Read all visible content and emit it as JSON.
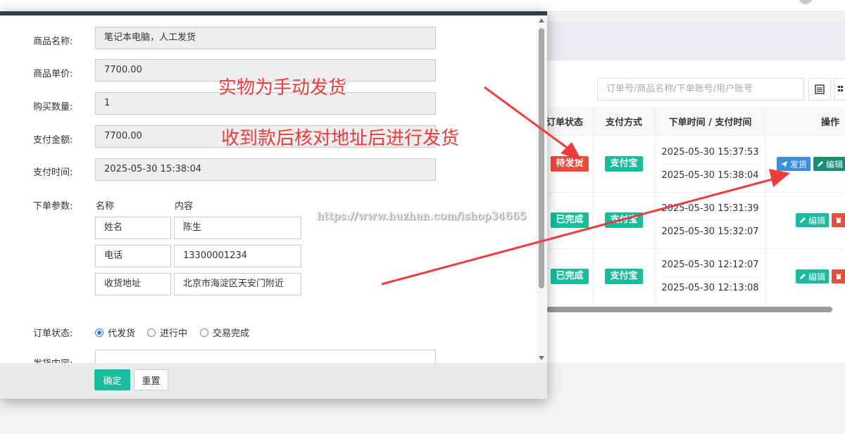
{
  "table": {
    "search_placeholder": "订单号/商品名称/下单账号/用户账号",
    "headers": [
      "订单状态",
      "支付方式",
      "下单时间 / 支付时间",
      "操作"
    ],
    "rows": [
      {
        "status": "待发货",
        "status_color": "#e74c3c",
        "pay": "支付宝",
        "order_time": "2025-05-30 15:37:53",
        "pay_time": "2025-05-30 15:38:04"
      },
      {
        "status": "已完成",
        "status_color": "#1abc9c",
        "pay": "支付宝",
        "order_time": "2025-05-30 15:31:39",
        "pay_time": "2025-05-30 15:32:07"
      },
      {
        "status": "已完成",
        "status_color": "#1abc9c",
        "pay": "支付宝",
        "order_time": "2025-05-30 12:12:07",
        "pay_time": "2025-05-30 12:13:08"
      }
    ],
    "actions": {
      "ship": "发货",
      "edit": "编辑"
    }
  },
  "modal": {
    "fields": [
      {
        "label": "商品名称:",
        "value": "笔记本电脑，人工发货"
      },
      {
        "label": "商品单价:",
        "value": "7700.00"
      },
      {
        "label": "购买数量:",
        "value": "1"
      },
      {
        "label": "支付金额:",
        "value": "7700.00"
      },
      {
        "label": "支付时间:",
        "value": "2025-05-30 15:38:04"
      }
    ],
    "params": {
      "label": "下单参数:",
      "col_name": "名称",
      "col_content": "内容",
      "rows": [
        {
          "name": "姓名",
          "content": "陈生"
        },
        {
          "name": "电话",
          "content": "13300001234"
        },
        {
          "name": "收货地址",
          "content": "北京市海淀区天安门附近"
        }
      ]
    },
    "status": {
      "label": "订单状态:",
      "options": [
        "代发货",
        "进行中",
        "交易完成"
      ],
      "selected": "代发货"
    },
    "delivery_label": "发货内容:",
    "confirm": "确定",
    "reset": "重置"
  },
  "annotations": {
    "line1": "实物为手动发货",
    "line2": "收到款后核对地址后进行发货",
    "color": "#ef3b3b"
  },
  "watermark": "https://www.huzhan.com/ishop34665"
}
